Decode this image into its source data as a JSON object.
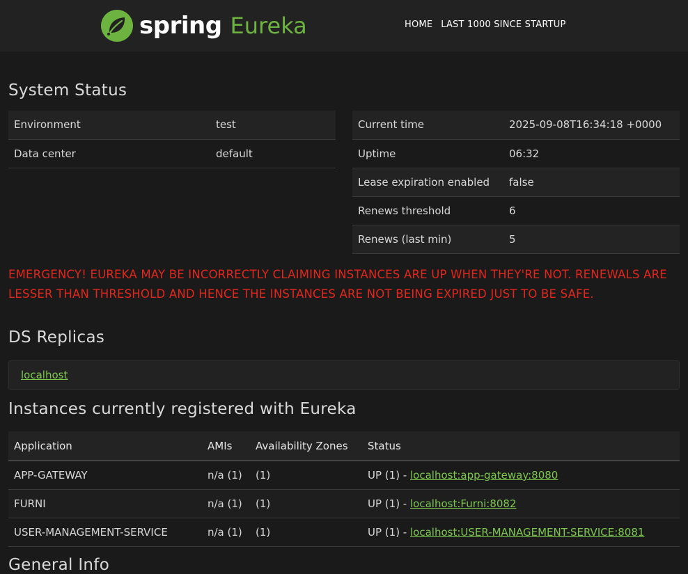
{
  "brand": {
    "spring": "spring",
    "eureka": "Eureka"
  },
  "nav": {
    "home": "HOME",
    "last1000": "LAST 1000 SINCE STARTUP"
  },
  "system_status": {
    "title": "System Status",
    "left": [
      {
        "key": "Environment",
        "value": "test"
      },
      {
        "key": "Data center",
        "value": "default"
      }
    ],
    "right": [
      {
        "key": "Current time",
        "value": "2025-09-08T16:34:18 +0000"
      },
      {
        "key": "Uptime",
        "value": "06:32"
      },
      {
        "key": "Lease expiration enabled",
        "value": "false"
      },
      {
        "key": "Renews threshold",
        "value": "6"
      },
      {
        "key": "Renews (last min)",
        "value": "5"
      }
    ]
  },
  "emergency": "EMERGENCY! EUREKA MAY BE INCORRECTLY CLAIMING INSTANCES ARE UP WHEN THEY'RE NOT. RENEWALS ARE LESSER THAN THRESHOLD AND HENCE THE INSTANCES ARE NOT BEING EXPIRED JUST TO BE SAFE.",
  "replicas": {
    "title": "DS Replicas",
    "link": "localhost"
  },
  "instances": {
    "title": "Instances currently registered with Eureka",
    "headers": [
      "Application",
      "AMIs",
      "Availability Zones",
      "Status"
    ],
    "rows": [
      {
        "app": "APP-GATEWAY",
        "amis": "n/a (1)",
        "zones": "(1)",
        "status": "UP (1) - ",
        "link": "localhost:app-gateway:8080"
      },
      {
        "app": "FURNI",
        "amis": "n/a (1)",
        "zones": "(1)",
        "status": "UP (1) - ",
        "link": "localhost:Furni:8082"
      },
      {
        "app": "USER-MANAGEMENT-SERVICE",
        "amis": "n/a (1)",
        "zones": "(1)",
        "status": "UP (1) - ",
        "link": "localhost:USER-MANAGEMENT-SERVICE:8081"
      }
    ]
  },
  "general_info": {
    "title": "General Info"
  },
  "colors": {
    "accent_green": "#6db33f",
    "link_green": "#7ec850",
    "emergency_red": "#e3271c",
    "background": "#1a1a1a",
    "navbar": "#222222"
  },
  "icons": {
    "logo": "spring-leaf-icon"
  }
}
